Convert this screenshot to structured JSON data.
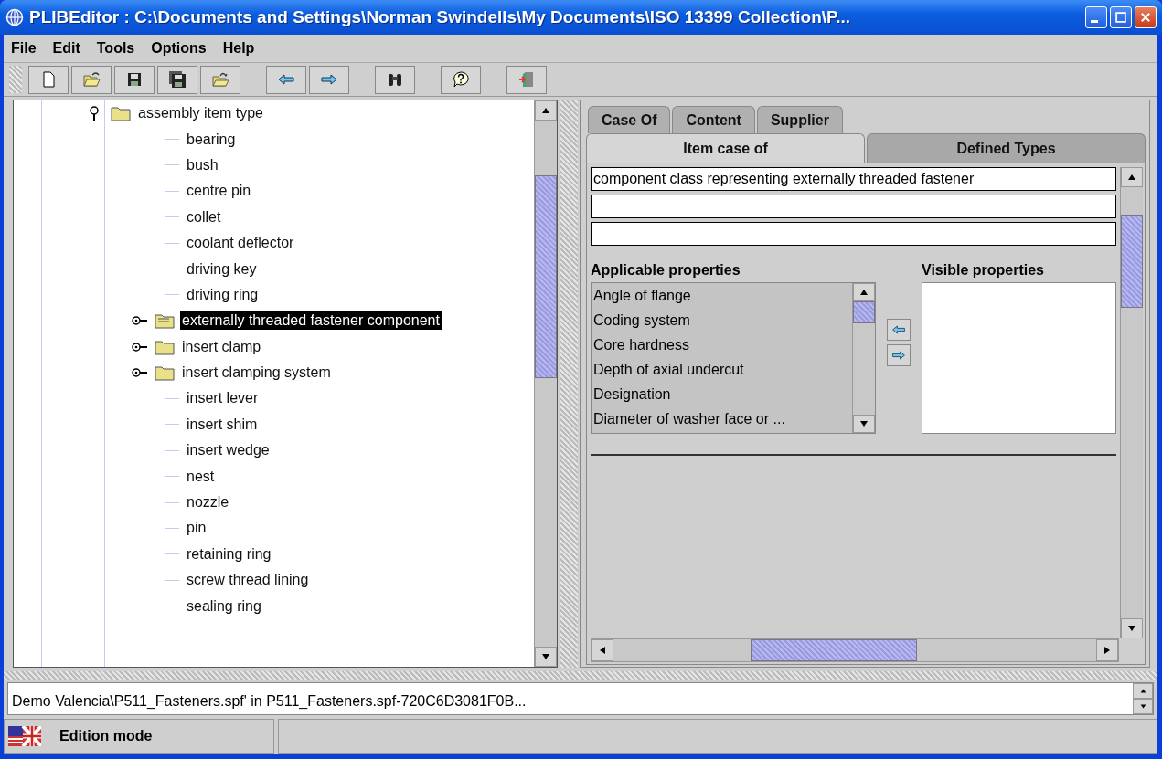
{
  "window": {
    "title": "PLIBEditor : C:\\Documents and Settings\\Norman Swindells\\My Documents\\ISO 13399 Collection\\P..."
  },
  "menu": [
    {
      "label": "File"
    },
    {
      "label": "Edit"
    },
    {
      "label": "Tools"
    },
    {
      "label": "Options"
    },
    {
      "label": "Help"
    }
  ],
  "tree": {
    "items": [
      {
        "label": "assembly item type",
        "kind": "folder",
        "expanded": true,
        "selected": false,
        "children": [
          {
            "label": "bearing",
            "kind": "leaf",
            "selected": false
          },
          {
            "label": "bush",
            "kind": "leaf",
            "selected": false
          },
          {
            "label": "centre pin",
            "kind": "leaf",
            "selected": false
          },
          {
            "label": "collet",
            "kind": "leaf",
            "selected": false
          },
          {
            "label": "coolant deflector",
            "kind": "leaf",
            "selected": false
          },
          {
            "label": "driving key",
            "kind": "leaf",
            "selected": false
          },
          {
            "label": "driving ring",
            "kind": "leaf",
            "selected": false
          },
          {
            "label": "externally threaded fastener component",
            "kind": "folder",
            "expanded": false,
            "selected": true
          },
          {
            "label": "insert clamp",
            "kind": "folder",
            "expanded": false,
            "selected": false
          },
          {
            "label": "insert clamping system",
            "kind": "folder",
            "expanded": false,
            "selected": false
          },
          {
            "label": "insert lever",
            "kind": "leaf",
            "selected": false
          },
          {
            "label": "insert shim",
            "kind": "leaf",
            "selected": false
          },
          {
            "label": "insert wedge",
            "kind": "leaf",
            "selected": false
          },
          {
            "label": "nest",
            "kind": "leaf",
            "selected": false
          },
          {
            "label": "nozzle",
            "kind": "leaf",
            "selected": false
          },
          {
            "label": "pin",
            "kind": "leaf",
            "selected": false
          },
          {
            "label": "retaining ring",
            "kind": "leaf",
            "selected": false
          },
          {
            "label": "screw thread lining",
            "kind": "leaf",
            "selected": false
          },
          {
            "label": "sealing ring",
            "kind": "leaf",
            "selected": false
          }
        ]
      }
    ]
  },
  "tabs_top": [
    {
      "label": "Case Of",
      "selected": false
    },
    {
      "label": "Content",
      "selected": false
    },
    {
      "label": "Supplier",
      "selected": false
    }
  ],
  "tabs": [
    {
      "label": "Item case of",
      "selected": true
    },
    {
      "label": "Defined Types",
      "selected": false
    }
  ],
  "fields": [
    {
      "kind": "text",
      "value": "component class representing externally threaded fastener"
    },
    {
      "kind": "blank"
    },
    {
      "kind": "blank"
    }
  ],
  "applicable": {
    "title": "Applicable properties",
    "items": [
      "Angle of flange",
      "Coding system",
      "Core hardness",
      "Depth of axial undercut",
      "Designation",
      "Diameter of washer face or ..."
    ]
  },
  "visible": {
    "title": "Visible properties"
  },
  "log": {
    "text": "Demo Valencia\\P511_Fasteners.spf' in P511_Fasteners.spf-720C6D3081F0B..."
  },
  "status_bar": {
    "mode": "Edition mode"
  }
}
